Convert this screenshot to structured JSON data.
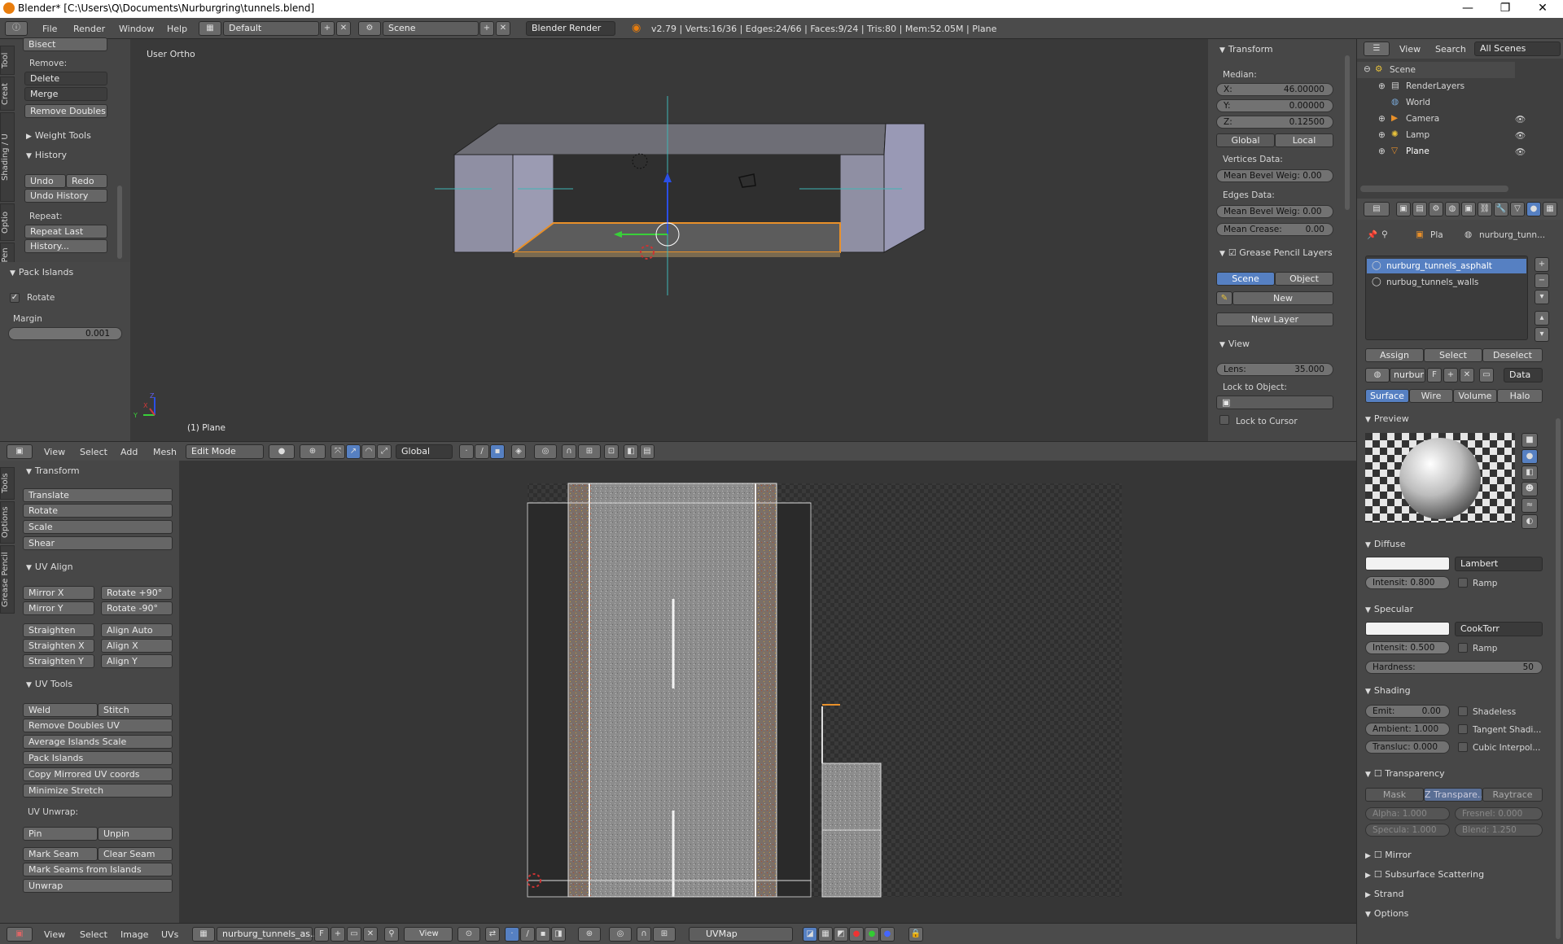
{
  "window": {
    "title": "Blender* [C:\\Users\\Q\\Documents\\Nurburgring\\tunnels.blend]",
    "min": "—",
    "max": "❐",
    "close": "✕"
  },
  "menubar": {
    "items": [
      "File",
      "Render",
      "Window",
      "Help"
    ],
    "layout": "Default",
    "scene": "Scene",
    "engine": "Blender Render",
    "stats": "v2.79 | Verts:16/36 | Edges:24/66 | Faces:9/24 | Tris:80 | Mem:52.05M | Plane"
  },
  "toolshelf_top": {
    "bisect": "Bisect",
    "remove_label": "Remove:",
    "delete": "Delete",
    "merge": "Merge",
    "remove_doubles": "Remove Doubles",
    "weight_tools": "Weight Tools",
    "history": "History",
    "undo": "Undo",
    "redo": "Redo",
    "undo_history": "Undo History",
    "repeat_label": "Repeat:",
    "repeat_last": "Repeat Last",
    "history_btn": "History...",
    "pack_islands": "Pack Islands",
    "rotate": "Rotate",
    "margin_label": "Margin",
    "margin_value": "0.001",
    "tabs": [
      "Tool",
      "Creat",
      "Shading / U",
      "Optio",
      "Grease Pen"
    ]
  },
  "viewport": {
    "label": "User Ortho",
    "object": "(1) Plane",
    "axis_z": "Z",
    "axis_y": "Y",
    "axis_x": "X"
  },
  "npanel": {
    "transform": "Transform",
    "median": "Median:",
    "x_label": "X:",
    "x_value": "46.00000",
    "y_label": "Y:",
    "y_value": "0.00000",
    "z_label": "Z:",
    "z_value": "0.12500",
    "global": "Global",
    "local": "Local",
    "vertices_data": "Vertices Data:",
    "mean_bevel_v": "Mean Bevel Weig: 0.00",
    "edges_data": "Edges Data:",
    "mean_bevel_e": "Mean Bevel Weig: 0.00",
    "mean_crease": "Mean Crease:",
    "mean_crease_val": "0.00",
    "grease": "Grease Pencil Layers",
    "scene": "Scene",
    "object": "Object",
    "new": "New",
    "new_layer": "New Layer",
    "view": "View",
    "lens_label": "Lens:",
    "lens_value": "35.000",
    "lock_obj": "Lock to Object:",
    "lock_cursor": "Lock to Cursor"
  },
  "view3d_header": {
    "items": [
      "View",
      "Select",
      "Add",
      "Mesh"
    ],
    "mode": "Edit Mode",
    "orientation": "Global"
  },
  "uv_toolshelf": {
    "transform": "Transform",
    "translate": "Translate",
    "rotate": "Rotate",
    "scale": "Scale",
    "shear": "Shear",
    "uv_align": "UV Align",
    "mirror_x": "Mirror X",
    "rotate_p90": "Rotate +90°",
    "mirror_y": "Mirror Y",
    "rotate_m90": "Rotate  -90°",
    "straighten": "Straighten",
    "align_auto": "Align Auto",
    "straighten_x": "Straighten X",
    "align_x": "Align X",
    "straighten_y": "Straighten Y",
    "align_y": "Align Y",
    "uv_tools": "UV Tools",
    "weld": "Weld",
    "stitch": "Stitch",
    "remove_doubles_uv": "Remove Doubles UV",
    "avg_islands": "Average Islands Scale",
    "pack_islands": "Pack Islands",
    "copy_mirrored": "Copy Mirrored UV coords",
    "min_stretch": "Minimize Stretch",
    "uv_unwrap": "UV Unwrap:",
    "pin": "Pin",
    "unpin": "Unpin",
    "mark_seam": "Mark Seam",
    "clear_seam": "Clear Seam",
    "mark_from_islands": "Mark Seams from Islands",
    "unwrap": "Unwrap",
    "tabs": [
      "Tools",
      "Options",
      "Grease Pencil"
    ]
  },
  "uv_header": {
    "items": [
      "View",
      "Select",
      "Image",
      "UVs"
    ],
    "image": "nurburg_tunnels_as...",
    "f": "F",
    "view": "View",
    "uvmap": "UVMap"
  },
  "outliner": {
    "view": "View",
    "search": "Search",
    "all_scenes": "All Scenes",
    "items": [
      "Scene",
      "RenderLayers",
      "World",
      "Camera",
      "Lamp",
      "Plane"
    ]
  },
  "properties": {
    "crumb_pla": "Pla",
    "crumb_mat": "nurburg_tunn...",
    "materials": [
      "nurburg_tunnels_asphalt",
      "nurbug_tunnels_walls"
    ],
    "assign": "Assign",
    "select": "Select",
    "deselect": "Deselect",
    "mat_name": "nurbur",
    "f": "F",
    "data": "Data",
    "tabs": [
      "Surface",
      "Wire",
      "Volume",
      "Halo"
    ],
    "preview": "Preview",
    "diffuse": "Diffuse",
    "lambert": "Lambert",
    "intensity_d": "Intensit: 0.800",
    "ramp": "Ramp",
    "specular": "Specular",
    "cooktorr": "CookTorr",
    "intensity_s": "Intensit: 0.500",
    "hardness_label": "Hardness:",
    "hardness_value": "50",
    "shading": "Shading",
    "emit_label": "Emit:",
    "emit_value": "0.00",
    "shadeless": "Shadeless",
    "ambient": "Ambient: 1.000",
    "tangent": "Tangent Shadi...",
    "transluc": "Transluc: 0.000",
    "cubic": "Cubic Interpol...",
    "transparency": "Transparency",
    "mask": "Mask",
    "ztransp": "Z Transpare...",
    "raytrace": "Raytrace",
    "alpha": "Alpha:   1.000",
    "fresnel": "Fresnel:  0.000",
    "specula": "Specula:  1.000",
    "blend": "Blend:   1.250",
    "mirror": "Mirror",
    "sss": "Subsurface Scattering",
    "strand": "Strand",
    "options": "Options"
  }
}
